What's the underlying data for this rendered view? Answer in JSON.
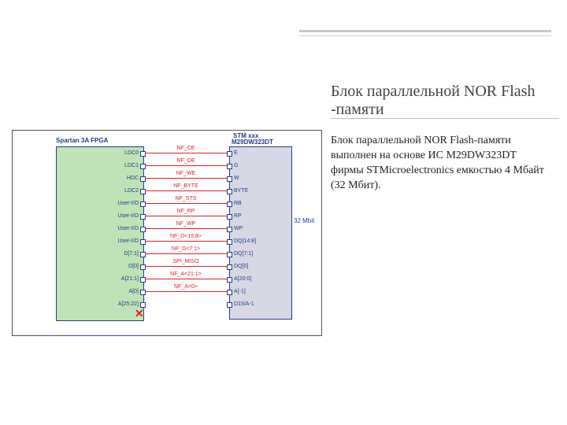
{
  "title": "Блок параллельной NOR Flash -памяти",
  "body": "Блок параллельной NOR Flash-памяти выполнен на основе ИС M29DW323DT фирмы STMicroelectronics емкостью 4 Мбайт (32 Мбит).",
  "fpga_title_1": "Spartan 3A FPGA",
  "fpga_title_2": "",
  "flash_title_1": "STM xxx",
  "flash_title_2": "M29DW323DT",
  "flash_side": "32 Mbit",
  "fpga_pins": [
    "LDC0",
    "LDC1",
    "HDC",
    "LDC2",
    "User-I/O",
    "User-I/O",
    "User-I/O",
    "User-I/O",
    "D[7:1]",
    "D[0]",
    "A[21:1]",
    "A[0]",
    "A[25:22]"
  ],
  "flash_pins": [
    "E",
    "G",
    "W",
    "BYTE",
    "RB",
    "RP",
    "WP",
    "DQ[14:8]",
    "DQ[7:1]",
    "DQ[0]",
    "A[20:0]",
    "A[-1]",
    "D15/A-1"
  ],
  "signals": [
    "NF_CE",
    "NF_OE",
    "NF_WE",
    "NF_BYTE",
    "NF_STS",
    "NF_RP",
    "NF_WP",
    "NF_D<15:8>",
    "NF_D<7:1>",
    "SPI_MISO",
    "NF_A<21:1>",
    "NF_A<0>"
  ],
  "x_symbol": "✕"
}
